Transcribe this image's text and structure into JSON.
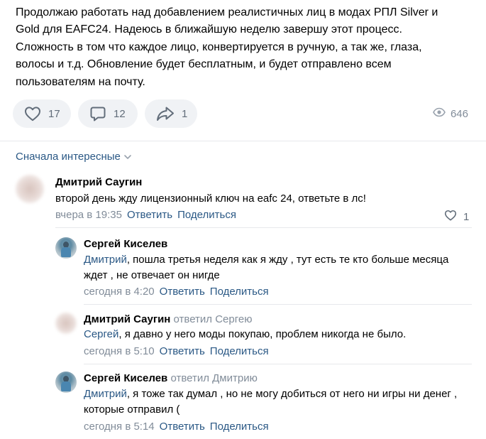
{
  "post": {
    "text": "Продолжаю работать над добавлением реалистичных лиц в модах РПЛ Silver и\nGold для EAFC24. Надеюсь в ближайшую неделю завершу этот процесс.\nСложность в том что каждое лицо, конвертируется в ручную, а так же, глаза,\nволосы и т.д. Обновление будет бесплатным, и будет отправлено всем\nпользователям на почту.",
    "likes": "17",
    "comments": "12",
    "shares": "1",
    "views": "646",
    "icons": [
      "heart-icon",
      "comment-icon",
      "share-icon",
      "eye-icon"
    ]
  },
  "sort_label": "Сначала интересные",
  "actions": {
    "reply": "Ответить",
    "share": "Поделиться"
  },
  "comments": [
    {
      "author": "Дмитрий Саугин",
      "replied_to": "",
      "mention": "",
      "text": "второй день жду лицензионный ключ на eafc 24, ответьте в лс!",
      "time": "вчера в 19:35",
      "likes": "1"
    },
    {
      "author": "Сергей Киселев",
      "replied_to": "",
      "mention": "Дмитрий",
      "text": ", пошла третья неделя как я жду , тут есть те кто больше месяца ждет , не отвечает он нигде",
      "time": "сегодня в 4:20"
    },
    {
      "author": "Дмитрий Саугин",
      "replied_to": "ответил Сергею",
      "mention": "Сергей",
      "text": ", я давно у него моды покупаю, проблем никогда не было.",
      "time": "сегодня в 5:10"
    },
    {
      "author": "Сергей Киселев",
      "replied_to": "ответил Дмитрию",
      "mention": "Дмитрий",
      "text": ", я тоже так думал , но не могу добиться от него ни игры ни денег , которые отправил (",
      "time": "сегодня в 5:14"
    }
  ]
}
